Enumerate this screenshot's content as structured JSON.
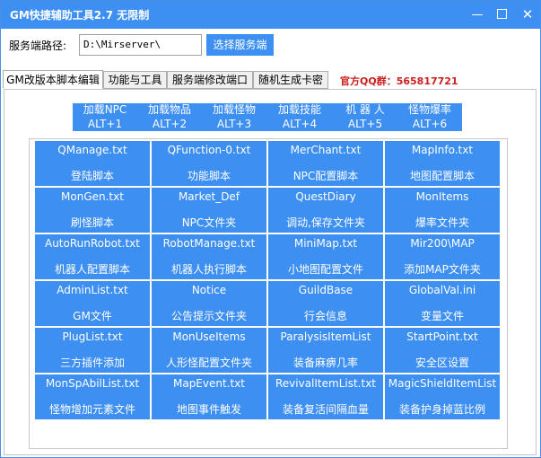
{
  "window": {
    "title": "GM快捷辅助工具2.7 无限制"
  },
  "path": {
    "label": "服务端路径:",
    "value": "D:\\Mirserver\\",
    "select_button": "选择服务端"
  },
  "tabs": [
    {
      "label": "GM改版本脚本编辑",
      "active": true
    },
    {
      "label": "功能与工具",
      "active": false
    },
    {
      "label": "服务端修改端口",
      "active": false
    },
    {
      "label": "随机生成卡密",
      "active": false
    }
  ],
  "qq_group": "官方QQ群：565817721",
  "shortcuts": [
    {
      "label": "加载NPC",
      "key": "ALT+1"
    },
    {
      "label": "加载物品",
      "key": "ALT+2"
    },
    {
      "label": "加载怪物",
      "key": "ALT+3"
    },
    {
      "label": "加载技能",
      "key": "ALT+4"
    },
    {
      "label": "机 器 人",
      "key": "ALT+5"
    },
    {
      "label": "怪物爆率",
      "key": "ALT+6"
    }
  ],
  "grid": [
    {
      "name": "QManage.txt",
      "desc": "登陆脚本"
    },
    {
      "name": "QFunction-0.txt",
      "desc": "功能脚本"
    },
    {
      "name": "MerChant.txt",
      "desc": "NPC配置脚本"
    },
    {
      "name": "MapInfo.txt",
      "desc": "地图配置脚本"
    },
    {
      "name": "MonGen.txt",
      "desc": "刷怪脚本"
    },
    {
      "name": "Market_Def",
      "desc": "NPC文件夹"
    },
    {
      "name": "QuestDiary",
      "desc": "调动,保存文件夹"
    },
    {
      "name": "MonItems",
      "desc": "爆率文件夹"
    },
    {
      "name": "AutoRunRobot.txt",
      "desc": "机器人配置脚本"
    },
    {
      "name": "RobotManage.txt",
      "desc": "机器人执行脚本"
    },
    {
      "name": "MiniMap.txt",
      "desc": "小地图配置文件"
    },
    {
      "name": "Mir200\\MAP",
      "desc": "添加MAP文件夹"
    },
    {
      "name": "AdminList.txt",
      "desc": "GM文件"
    },
    {
      "name": "Notice",
      "desc": "公告提示文件夹"
    },
    {
      "name": "GuildBase",
      "desc": "行会信息"
    },
    {
      "name": "GlobalVal.ini",
      "desc": "变量文件"
    },
    {
      "name": "PlugList.txt",
      "desc": "三方插件添加"
    },
    {
      "name": "MonUseItems",
      "desc": "人形怪配置文件夹"
    },
    {
      "name": "ParalysisItemList",
      "desc": "装备麻痹几率"
    },
    {
      "name": "StartPoint.txt",
      "desc": "安全区设置"
    },
    {
      "name": "MonSpAbilList.txt",
      "desc": "怪物增加元素文件"
    },
    {
      "name": "MapEvent.txt",
      "desc": "地图事件触发"
    },
    {
      "name": "RevivalItemList.txt",
      "desc": "装备复活间隔血量"
    },
    {
      "name": "MagicShieldItemList",
      "desc": "装备护身掉蓝比例"
    }
  ],
  "colors": {
    "accent": "#3d8ff2",
    "qq_text": "#cc1f1f"
  },
  "icons": {
    "minimize": "minimize-icon",
    "maximize": "maximize-icon",
    "close": "close-icon"
  }
}
